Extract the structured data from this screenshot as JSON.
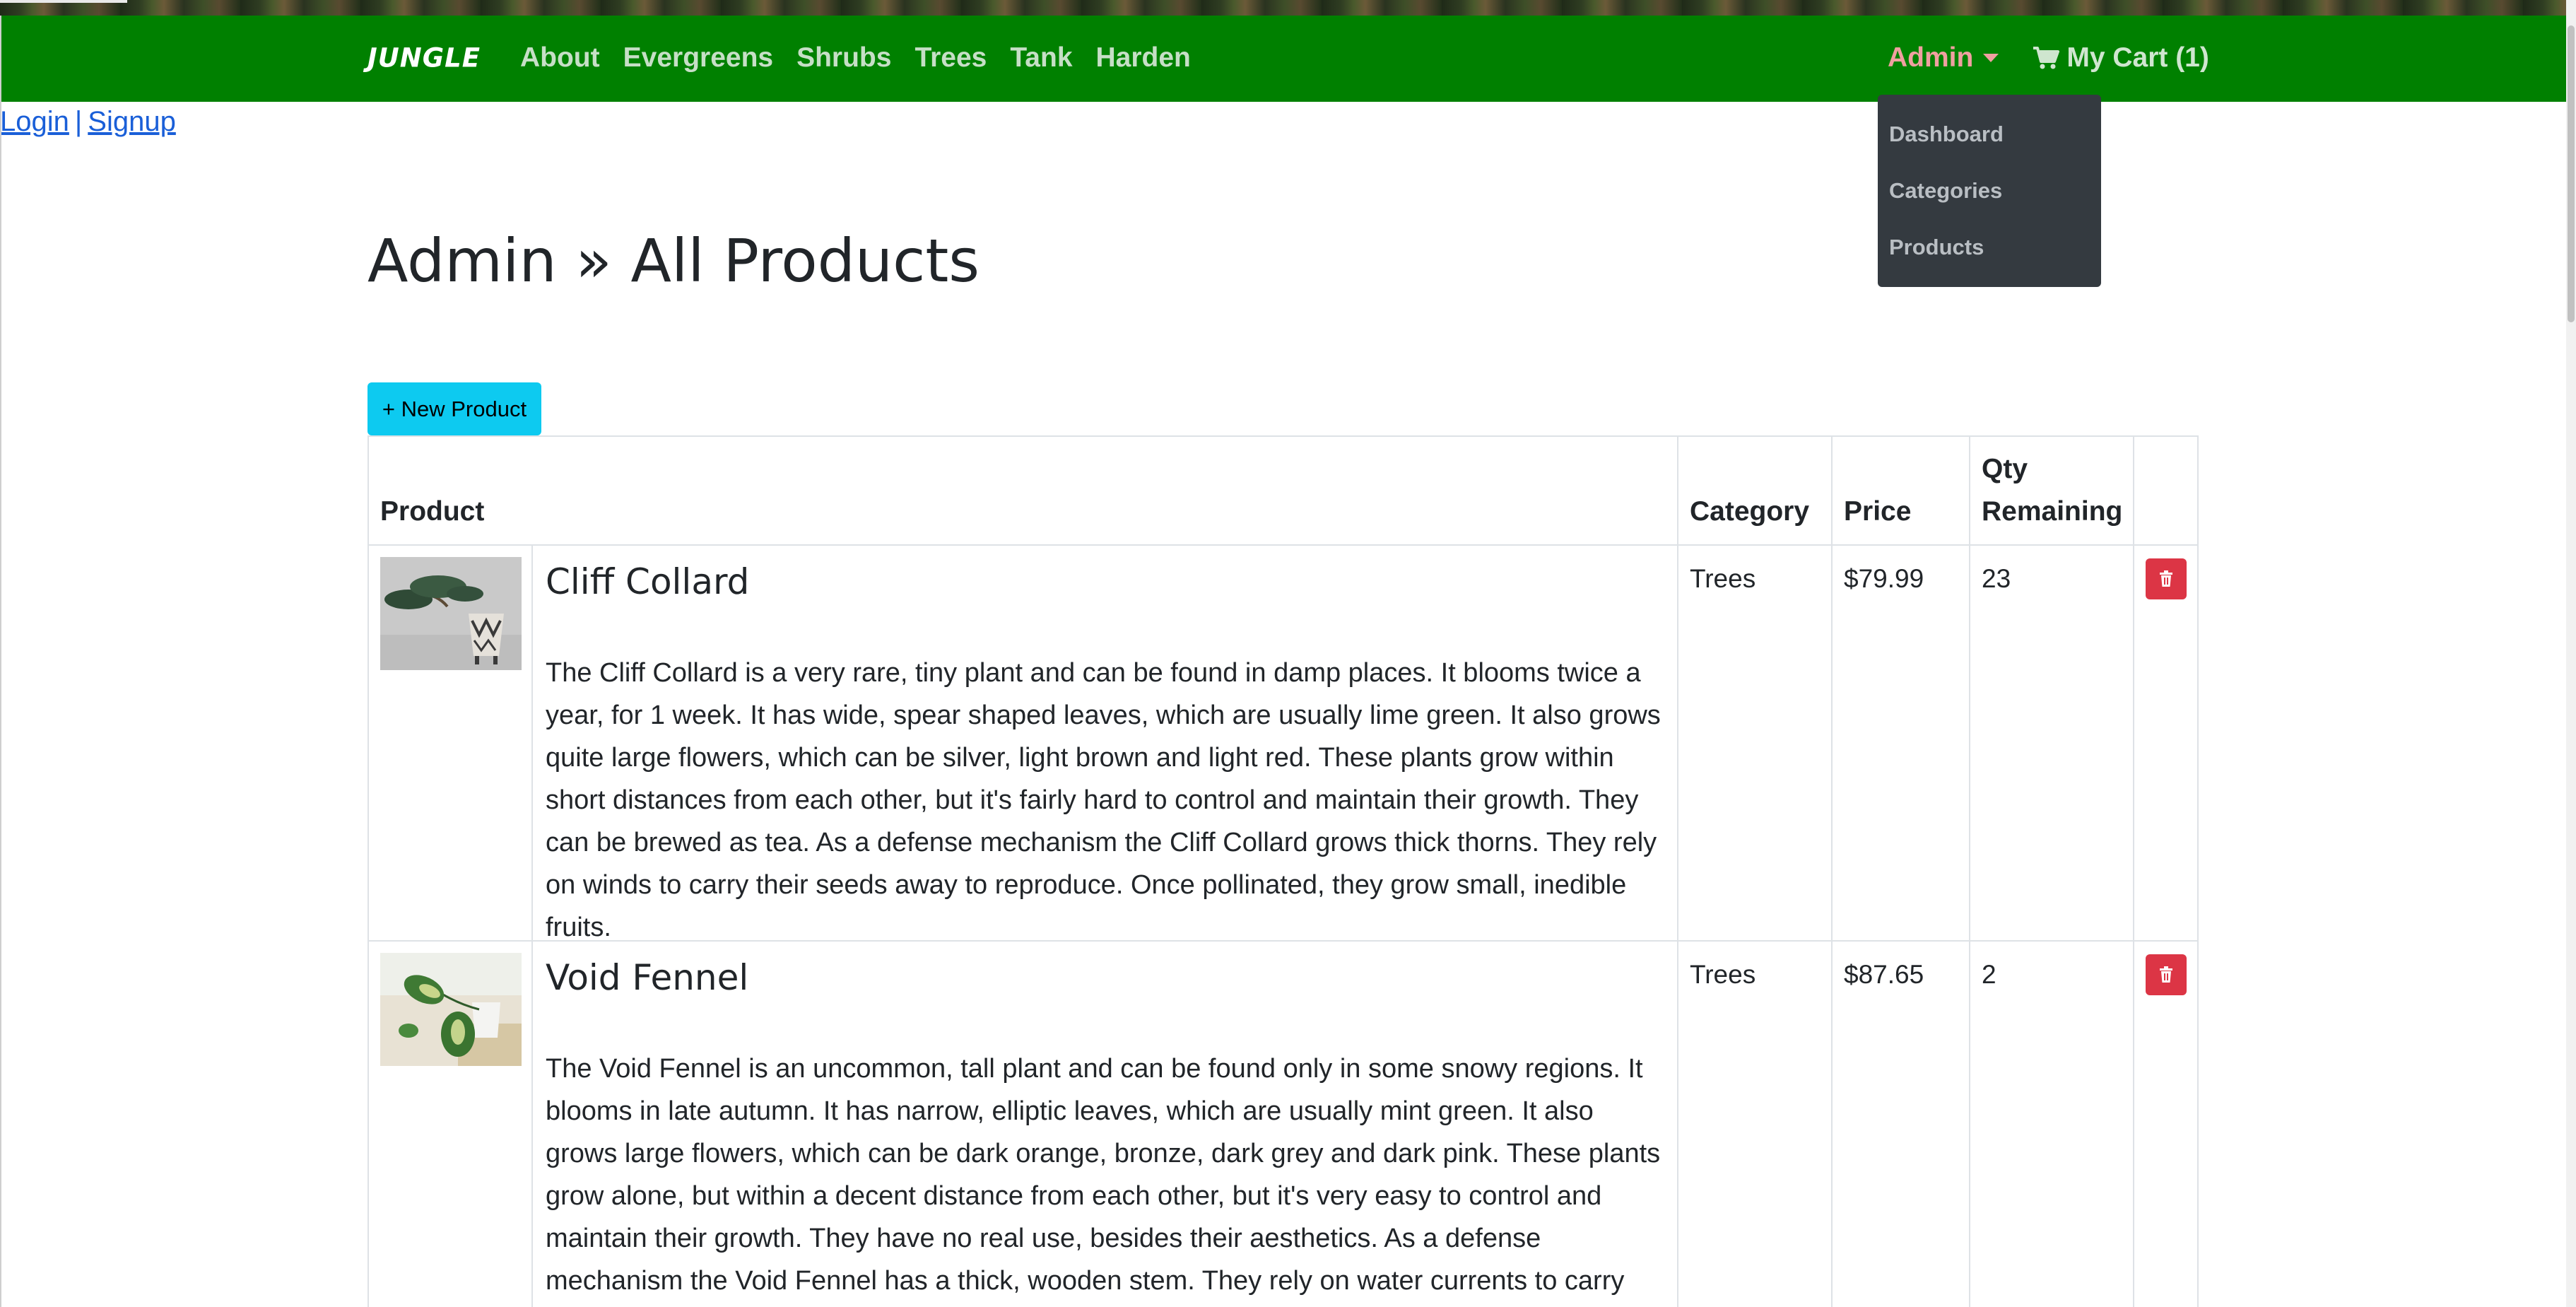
{
  "navbar": {
    "brand": "JUNGLE",
    "links": [
      "About",
      "Evergreens",
      "Shrubs",
      "Trees",
      "Tank",
      "Harden"
    ],
    "admin_label": "Admin",
    "cart_label": "My Cart (1)",
    "colors": {
      "bg": "#008000",
      "admin": "#f0a0a0"
    }
  },
  "admin_menu": {
    "items": [
      "Dashboard",
      "Categories",
      "Products"
    ]
  },
  "auth": {
    "login": "Login",
    "separator": "|",
    "signup": "Signup"
  },
  "page": {
    "title": "Admin » All Products",
    "new_button": "+ New Product"
  },
  "table": {
    "headers": {
      "product": "Product",
      "category": "Category",
      "price": "Price",
      "qty_line1": "Qty",
      "qty_line2": "Remaining"
    },
    "rows": [
      {
        "name": "Cliff Collard",
        "description": "The Cliff Collard is a very rare, tiny plant and can be found in damp places. It blooms twice a year, for 1 week. It has wide, spear shaped leaves, which are usually lime green. It also grows quite large flowers, which can be silver, light brown and light red. These plants grow within short distances from each other, but it's fairly hard to control and maintain their growth. They can be brewed as tea. As a defense mechanism the Cliff Collard grows thick thorns. They rely on winds to carry their seeds away to reproduce. Once pollinated, they grow small, inedible fruits.",
        "category": "Trees",
        "price": "$79.99",
        "qty": "23",
        "image_icon": "bonsai-plant-image"
      },
      {
        "name": "Void Fennel",
        "description": "The Void Fennel is an uncommon, tall plant and can be found only in some snowy regions. It blooms in late autumn. It has narrow, elliptic leaves, which are usually mint green. It also grows large flowers, which can be dark orange, bronze, dark grey and dark pink. These plants grow alone, but within a decent distance from each other, but it's very easy to control and maintain their growth. They have no real use, besides their aesthetics. As a defense mechanism the Void Fennel has a thick, wooden stem. They rely on water currents to carry their seeds away to",
        "category": "Trees",
        "price": "$87.65",
        "qty": "2",
        "image_icon": "pothos-plant-image"
      }
    ],
    "delete_icon": "trash-icon",
    "delete_color": "#dc3545"
  }
}
